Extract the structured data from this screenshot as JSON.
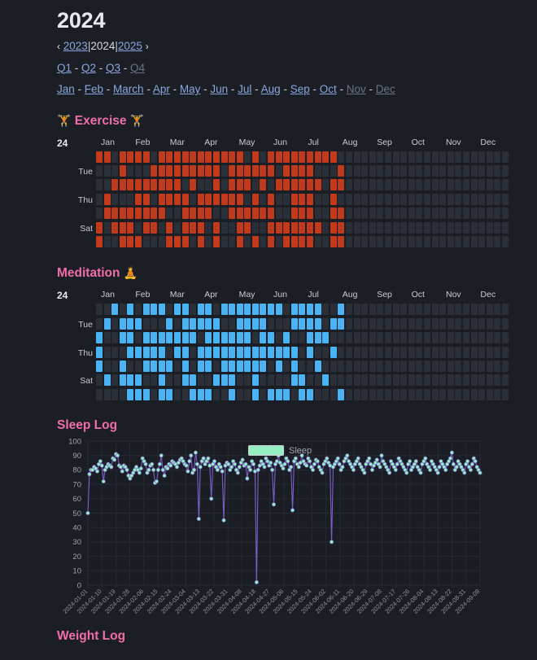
{
  "header": {
    "year_title": "2024",
    "prev_chevron": "‹",
    "next_chevron": "›",
    "prev_year": "2023",
    "current_year": "2024",
    "next_year": "2025",
    "pipe": "|",
    "quarters": [
      {
        "label": "Q1",
        "active": true
      },
      {
        "label": "Q2",
        "active": true
      },
      {
        "label": "Q3",
        "active": true
      },
      {
        "label": "Q4",
        "active": false
      }
    ],
    "months": [
      {
        "label": "Jan",
        "active": true
      },
      {
        "label": "Feb",
        "active": true
      },
      {
        "label": "March",
        "active": true
      },
      {
        "label": "Apr",
        "active": true
      },
      {
        "label": "May",
        "active": true
      },
      {
        "label": "Jun",
        "active": true
      },
      {
        "label": "Jul",
        "active": true
      },
      {
        "label": "Aug",
        "active": true
      },
      {
        "label": "Sep",
        "active": true
      },
      {
        "label": "Oct",
        "active": true
      },
      {
        "label": "Nov",
        "active": false
      },
      {
        "label": "Dec",
        "active": false
      }
    ],
    "dash": "-"
  },
  "colors": {
    "page_bg": "#1b1e24",
    "accent_pink": "#f06fa8",
    "link_blue": "#8aa8e0",
    "exercise_cell": "#c23a1c",
    "meditation_cell": "#4ab3f4",
    "empty_cell": "#2b2f37",
    "sleep_marker": "#95efc3",
    "sleep_line": "#7b5fc8"
  },
  "exercise": {
    "title": "Exercise",
    "emoji_left": "🏋️",
    "emoji_right": "🏋️",
    "year_label": "24",
    "day_labels": [
      "",
      "Tue",
      "",
      "Thu",
      "",
      "Sat",
      ""
    ],
    "month_labels": [
      "Jan",
      "Feb",
      "Mar",
      "Apr",
      "May",
      "Jun",
      "Jul",
      "Aug",
      "Sep",
      "Oct",
      "Nov",
      "Dec"
    ],
    "weeks": 53,
    "filled_fraction_through_week": 32
  },
  "meditation": {
    "title": "Meditation",
    "emoji_right": "🧘",
    "year_label": "24",
    "day_labels": [
      "",
      "Tue",
      "",
      "Thu",
      "",
      "Sat",
      ""
    ],
    "month_labels": [
      "Jan",
      "Feb",
      "Mar",
      "Apr",
      "May",
      "Jun",
      "Jul",
      "Aug",
      "Sep",
      "Oct",
      "Nov",
      "Dec"
    ],
    "weeks": 53
  },
  "sleep": {
    "title": "Sleep Log",
    "legend_label": "Sleep"
  },
  "weight": {
    "title": "Weight Log"
  },
  "chart_data": {
    "type": "line",
    "title": "Sleep Log",
    "xlabel": "",
    "ylabel": "",
    "ylim": [
      0,
      100
    ],
    "yticks": [
      0,
      10,
      20,
      30,
      40,
      50,
      60,
      70,
      80,
      90,
      100
    ],
    "grid": true,
    "legend_position": "top-center",
    "legend": [
      "Sleep"
    ],
    "marker_color": "#95efc3",
    "line_color": "#7b5fc8",
    "x_start": "2024-01-01",
    "x_end": "2024-09-08",
    "xtick_step_days": 9,
    "xticks": [
      "2024-01-01",
      "2024-01-10",
      "2024-01-19",
      "2024-01-28",
      "2024-02-06",
      "2024-02-15",
      "2024-02-24",
      "2024-03-04",
      "2024-03-13",
      "2024-03-22",
      "2024-03-31",
      "2024-04-08",
      "2024-04-18",
      "2024-04-27",
      "2024-05-06",
      "2024-05-15",
      "2024-05-24",
      "2024-06-02",
      "2024-06-11",
      "2024-06-20",
      "2024-06-29",
      "2024-07-08",
      "2024-07-17",
      "2024-07-26",
      "2024-08-04",
      "2024-08-13",
      "2024-08-22",
      "2024-08-31",
      "2024-09-08"
    ],
    "series": [
      {
        "name": "Sleep",
        "values": [
          50,
          77,
          80,
          80,
          82,
          81,
          79,
          84,
          86,
          83,
          72,
          80,
          82,
          84,
          83,
          82,
          88,
          87,
          91,
          90,
          83,
          82,
          79,
          83,
          82,
          80,
          76,
          74,
          76,
          78,
          80,
          82,
          80,
          78,
          81,
          88,
          86,
          84,
          78,
          80,
          83,
          84,
          80,
          71,
          72,
          80,
          84,
          90,
          80,
          76,
          82,
          81,
          84,
          83,
          86,
          85,
          84,
          82,
          85,
          87,
          88,
          86,
          84,
          83,
          79,
          86,
          90,
          78,
          80,
          92,
          84,
          46,
          82,
          86,
          88,
          84,
          86,
          88,
          83,
          60,
          84,
          86,
          82,
          80,
          84,
          82,
          79,
          45,
          83,
          85,
          84,
          80,
          82,
          86,
          84,
          80,
          78,
          82,
          85,
          87,
          83,
          84,
          74,
          82,
          80,
          86,
          84,
          79,
          2,
          80,
          83,
          86,
          84,
          82,
          88,
          86,
          83,
          85,
          80,
          56,
          84,
          86,
          90,
          85,
          83,
          81,
          84,
          88,
          86,
          80,
          82,
          52,
          86,
          88,
          84,
          82,
          85,
          90,
          86,
          84,
          83,
          88,
          86,
          82,
          80,
          84,
          87,
          86,
          82,
          80,
          78,
          84,
          86,
          88,
          85,
          83,
          30,
          82,
          84,
          86,
          88,
          84,
          80,
          82,
          86,
          88,
          90,
          86,
          84,
          82,
          80,
          84,
          86,
          88,
          84,
          82,
          80,
          78,
          84,
          86,
          88,
          84,
          80,
          83,
          85,
          87,
          84,
          82,
          90,
          86,
          84,
          82,
          80,
          78,
          86,
          84,
          82,
          80,
          84,
          88,
          86,
          84,
          82,
          80,
          78,
          84,
          86,
          80,
          82,
          84,
          86,
          82,
          80,
          78,
          84,
          86,
          88,
          84,
          82,
          80,
          86,
          84,
          82,
          80,
          78,
          82,
          86,
          84,
          82,
          80,
          84,
          86,
          88,
          92,
          84,
          80,
          82,
          86,
          84,
          82,
          80,
          78,
          84,
          86,
          82,
          80,
          84,
          88,
          86,
          82,
          80,
          78
        ]
      }
    ]
  }
}
